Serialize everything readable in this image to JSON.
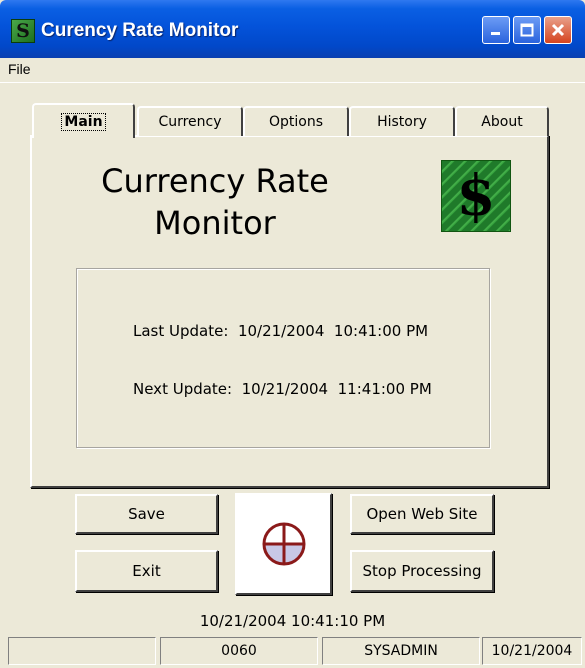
{
  "window": {
    "title": "Curency Rate Monitor",
    "icon_glyph": "S"
  },
  "menu": {
    "file": "File"
  },
  "tabs": [
    {
      "label": "Main",
      "active": true
    },
    {
      "label": "Currency",
      "active": false
    },
    {
      "label": "Options",
      "active": false
    },
    {
      "label": "History",
      "active": false
    },
    {
      "label": "About",
      "active": false
    }
  ],
  "main": {
    "heading_line1": "Currency Rate",
    "heading_line2": "Monitor",
    "logo_glyph": "$",
    "last_update_label": "Last Update:",
    "last_update_value": "10/21/2004  10:41:00 PM",
    "next_update_label": "Next Update:",
    "next_update_value": "10/21/2004  11:41:00 PM"
  },
  "buttons": {
    "save": "Save",
    "exit": "Exit",
    "open_web_site": "Open Web Site",
    "stop_processing": "Stop Processing"
  },
  "timestamp": "10/21/2004  10:41:10 PM",
  "statusbar": {
    "panel1": "",
    "panel2": "0060",
    "panel3": "SYSADMIN",
    "panel4": "10/21/2004"
  },
  "colors": {
    "titlebar": "#0453DA",
    "face": "#ECE9D8",
    "indicator": "#8B1A1A"
  },
  "icons": {
    "minimize": "minimize-icon",
    "maximize": "maximize-icon",
    "close": "close-icon",
    "app": "app-dollar-icon",
    "logo": "dollar-logo-icon",
    "activity": "activity-indicator-icon"
  }
}
